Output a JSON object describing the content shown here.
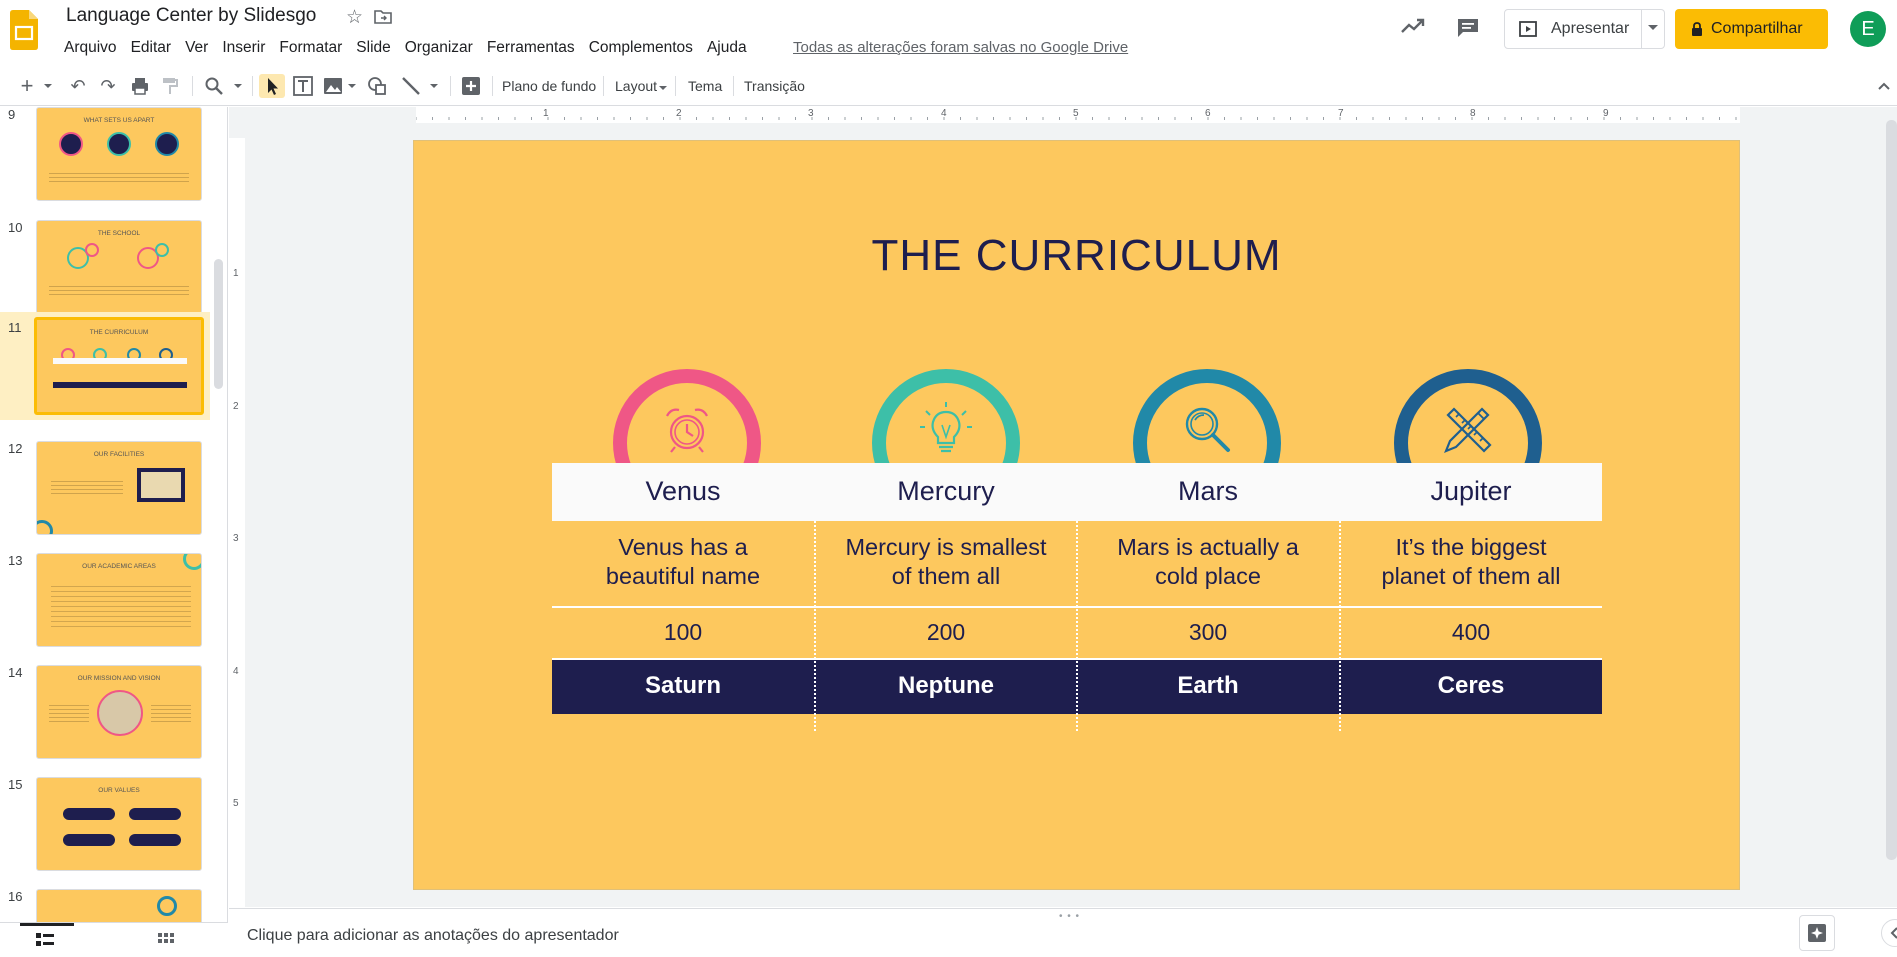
{
  "app": {
    "title": "Language Center by Slidesgo",
    "save_status": "Todas as alterações foram salvas no Google Drive",
    "user_initial": "E"
  },
  "menu": [
    "Arquivo",
    "Editar",
    "Ver",
    "Inserir",
    "Formatar",
    "Slide",
    "Organizar",
    "Ferramentas",
    "Complementos",
    "Ajuda"
  ],
  "buttons": {
    "present": "Apresentar",
    "share": "Compartilhar"
  },
  "toolbar": {
    "background": "Plano de fundo",
    "layout": "Layout",
    "theme": "Tema",
    "transition": "Transição"
  },
  "ruler": {
    "top": [
      "1",
      "2",
      "3",
      "4",
      "5",
      "6",
      "7",
      "8",
      "9"
    ],
    "left": [
      "1",
      "2",
      "3",
      "4",
      "5"
    ]
  },
  "filmstrip": [
    {
      "num": "9",
      "title": "WHAT SETS US APART"
    },
    {
      "num": "10",
      "title": "THE SCHOOL"
    },
    {
      "num": "11",
      "title": "THE CURRICULUM"
    },
    {
      "num": "12",
      "title": "OUR FACILITIES"
    },
    {
      "num": "13",
      "title": "OUR ACADEMIC AREAS"
    },
    {
      "num": "14",
      "title": "OUR MISSION AND VISION"
    },
    {
      "num": "15",
      "title": "OUR VALUES"
    },
    {
      "num": "16",
      "title": ""
    }
  ],
  "slide": {
    "title": "THE CURRICULUM",
    "columns": [
      {
        "name": "Venus",
        "desc1": "Venus has a",
        "desc2": "beautiful name",
        "value": "100",
        "footer": "Saturn",
        "ring_color": "#ef5786",
        "icon": "alarm-clock-icon"
      },
      {
        "name": "Mercury",
        "desc1": "Mercury is smallest",
        "desc2": "of them all",
        "value": "200",
        "footer": "Neptune",
        "ring_color": "#3dbfa8",
        "icon": "light-bulb-icon"
      },
      {
        "name": "Mars",
        "desc1": "Mars is actually a",
        "desc2": "cold place",
        "value": "300",
        "footer": "Earth",
        "ring_color": "#2189a8",
        "icon": "magnifier-icon"
      },
      {
        "name": "Jupiter",
        "desc1": "It’s the biggest",
        "desc2": "planet of them all",
        "value": "400",
        "footer": "Ceres",
        "ring_color": "#1f5f8f",
        "icon": "ruler-pencil-icon"
      }
    ]
  },
  "notes": {
    "placeholder": "Clique para adicionar as anotações do apresentador"
  },
  "colors": {
    "slide_bg": "#fdc85e",
    "navy": "#1e1e4e",
    "accent_yellow": "#fbbc04"
  }
}
